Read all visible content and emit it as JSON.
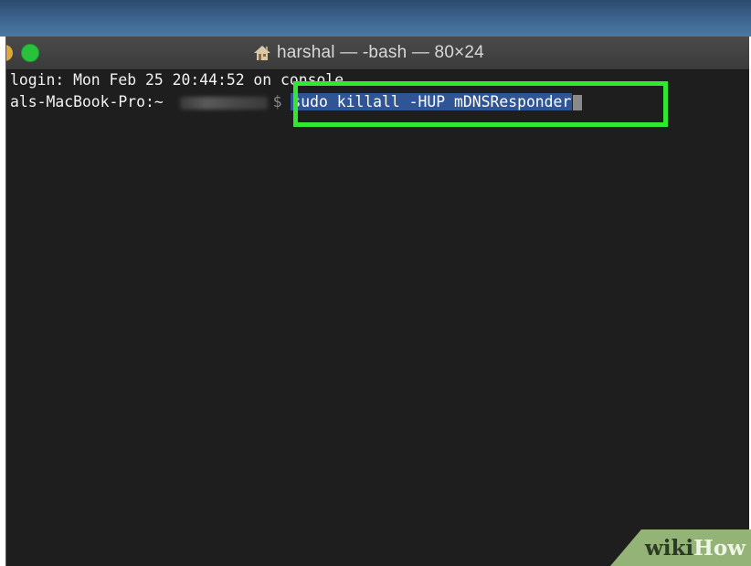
{
  "window": {
    "title": "harshal — -bash — 80×24",
    "icon": "house-icon"
  },
  "terminal": {
    "line1": "login: Mon Feb 25 20:44:52 on console",
    "prompt_host": "als-MacBook-Pro:~ ",
    "prompt_user_redacted": "harshal",
    "prompt_symbol": "$",
    "command": "sudo killall -HUP mDNSResponder"
  },
  "colors": {
    "terminal_bg": "#1e1e1e",
    "selection": "#2f5596",
    "highlight_box": "#30e830"
  },
  "watermark": {
    "wiki": "wiki",
    "how": "How"
  }
}
